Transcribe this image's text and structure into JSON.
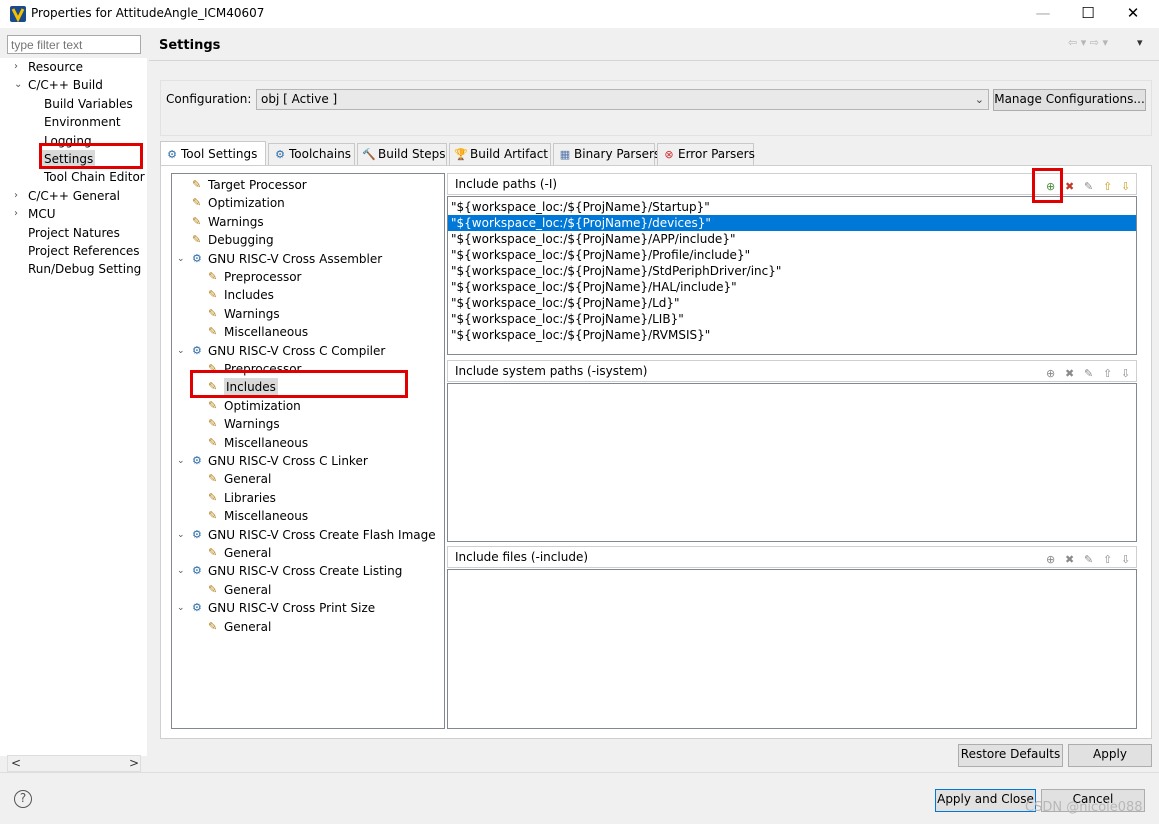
{
  "window": {
    "title": "Properties for AttitudeAngle_ICM40607",
    "minimize": "—",
    "maximize": "☐",
    "close": "✕"
  },
  "filter_placeholder": "type filter text",
  "nav_tree": [
    {
      "label": "Resource",
      "twisty": "›",
      "indent": 0
    },
    {
      "label": "C/C++ Build",
      "twisty": "⌄",
      "indent": 0
    },
    {
      "label": "Build Variables",
      "indent": 1
    },
    {
      "label": "Environment",
      "indent": 1
    },
    {
      "label": "Logging",
      "indent": 1
    },
    {
      "label": "Settings",
      "indent": 1,
      "selected": true
    },
    {
      "label": "Tool Chain Editor",
      "indent": 1
    },
    {
      "label": "C/C++ General",
      "twisty": "›",
      "indent": 0
    },
    {
      "label": "MCU",
      "twisty": "›",
      "indent": 0
    },
    {
      "label": "Project Natures",
      "indent": 0
    },
    {
      "label": "Project References",
      "indent": 0
    },
    {
      "label": "Run/Debug Setting",
      "indent": 0
    }
  ],
  "scroll_left": "<",
  "scroll_right": ">",
  "pane_title": "Settings",
  "nav_arrows": "⇦ ▾ ⇨ ▾",
  "nav_menu": "▾",
  "config": {
    "label": "Configuration:",
    "value": "obj  [ Active ]",
    "manage_button": "Manage Configurations..."
  },
  "tabs": [
    {
      "label": "Tool Settings",
      "icon": "gear-icon",
      "active": true
    },
    {
      "label": "Toolchains",
      "icon": "gear-icon"
    },
    {
      "label": "Build Steps",
      "icon": "hammer-icon"
    },
    {
      "label": "Build Artifact",
      "icon": "trophy-icon"
    },
    {
      "label": "Binary Parsers",
      "icon": "binary-icon"
    },
    {
      "label": "Error Parsers",
      "icon": "error-icon"
    }
  ],
  "tool_tree": [
    {
      "label": "Target Processor",
      "level": 0
    },
    {
      "label": "Optimization",
      "level": 0
    },
    {
      "label": "Warnings",
      "level": 0
    },
    {
      "label": "Debugging",
      "level": 0
    },
    {
      "label": "GNU RISC-V Cross Assembler",
      "level": 0,
      "expandable": true
    },
    {
      "label": "Preprocessor",
      "level": 1
    },
    {
      "label": "Includes",
      "level": 1
    },
    {
      "label": "Warnings",
      "level": 1
    },
    {
      "label": "Miscellaneous",
      "level": 1
    },
    {
      "label": "GNU RISC-V Cross C Compiler",
      "level": 0,
      "expandable": true
    },
    {
      "label": "Preprocessor",
      "level": 1
    },
    {
      "label": "Includes",
      "level": 1,
      "selected": true
    },
    {
      "label": "Optimization",
      "level": 1
    },
    {
      "label": "Warnings",
      "level": 1
    },
    {
      "label": "Miscellaneous",
      "level": 1
    },
    {
      "label": "GNU RISC-V Cross C Linker",
      "level": 0,
      "expandable": true
    },
    {
      "label": "General",
      "level": 1
    },
    {
      "label": "Libraries",
      "level": 1
    },
    {
      "label": "Miscellaneous",
      "level": 1
    },
    {
      "label": "GNU RISC-V Cross Create Flash Image",
      "level": 0,
      "expandable": true
    },
    {
      "label": "General",
      "level": 1
    },
    {
      "label": "GNU RISC-V Cross Create Listing",
      "level": 0,
      "expandable": true
    },
    {
      "label": "General",
      "level": 1
    },
    {
      "label": "GNU RISC-V Cross Print Size",
      "level": 0,
      "expandable": true
    },
    {
      "label": "General",
      "level": 1
    }
  ],
  "include_paths": {
    "title": "Include paths (-I)",
    "items": [
      "\"${workspace_loc:/${ProjName}/Startup}\"",
      "\"${workspace_loc:/${ProjName}/devices}\"",
      "\"${workspace_loc:/${ProjName}/APP/include}\"",
      "\"${workspace_loc:/${ProjName}/Profile/include}\"",
      "\"${workspace_loc:/${ProjName}/StdPeriphDriver/inc}\"",
      "\"${workspace_loc:/${ProjName}/HAL/include}\"",
      "\"${workspace_loc:/${ProjName}/Ld}\"",
      "\"${workspace_loc:/${ProjName}/LIB}\"",
      "\"${workspace_loc:/${ProjName}/RVMSIS}\""
    ],
    "selected_index": 1
  },
  "include_system_paths": {
    "title": "Include system paths (-isystem)",
    "items": []
  },
  "include_files": {
    "title": "Include files (-include)",
    "items": []
  },
  "buttons": {
    "restore_defaults": "Restore Defaults",
    "apply": "Apply",
    "apply_and_close": "Apply and Close",
    "cancel": "Cancel",
    "help": "?"
  },
  "watermark": "CSDN @nicole088",
  "colors": {
    "selection": "#0078d7",
    "highlight_box": "#e00000"
  }
}
